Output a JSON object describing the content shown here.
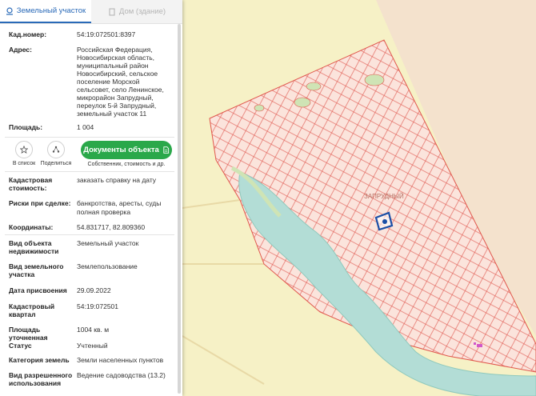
{
  "tabs": {
    "land": "Земельный участок",
    "building": "Дом (здание)"
  },
  "fields": {
    "cadastral_number_label": "Кад.номер:",
    "cadastral_number_value": "54:19:072501:8397",
    "address_label": "Адрес:",
    "address_value": "Российская Федерация, Новосибирская область, муниципальный район Новосибирский, сельское поселение Морской сельсовет, село Ленинское, микрорайон Запрудный, переулок 5-й Запрудный, земельный участок 11",
    "area_label": "Площадь:",
    "area_value": "1 004",
    "cadastral_cost_label": "Кадастровая стоимость:",
    "cadastral_cost_value": "заказать справку на дату",
    "risks_label": "Риски при сделке:",
    "risks_value": "банкротства, аресты, суды",
    "risks_link": "полная проверка",
    "coords_label": "Координаты:",
    "coords_value": "54.831717, 82.809360",
    "object_type_label": "Вид объекта недвижимости",
    "object_type_value": "Земельный участок",
    "land_type_label": "Вид земельного участка",
    "land_type_value": "Землепользование",
    "assign_date_label": "Дата присвоения",
    "assign_date_value": "29.09.2022",
    "quarter_label": "Кадастровый квартал",
    "quarter_value": "54:19:072501",
    "specified_area_label": "Площадь уточненная",
    "specified_area_value": "1004 кв. м",
    "status_label": "Статус",
    "status_value": "Учтенный",
    "category_label": "Категория земель",
    "category_value": "Земли населенных пунктов",
    "permitted_use_label": "Вид разрешенного использования",
    "permitted_use_value": "Ведение садоводства (13.2)"
  },
  "actions": {
    "list_label": "В список",
    "share_label": "Поделиться",
    "docs_button": "Документы объекта",
    "docs_sub": "Собственник, стоимость и др."
  },
  "map": {
    "district_label": "ЗАПРУДНЫЙ",
    "colors": {
      "background": "#f6f1c6",
      "parcels": "#fbe4dc",
      "parcel_lines": "#e0574d",
      "water": "#b3ddd6",
      "selected": "#1b4fa6"
    }
  }
}
